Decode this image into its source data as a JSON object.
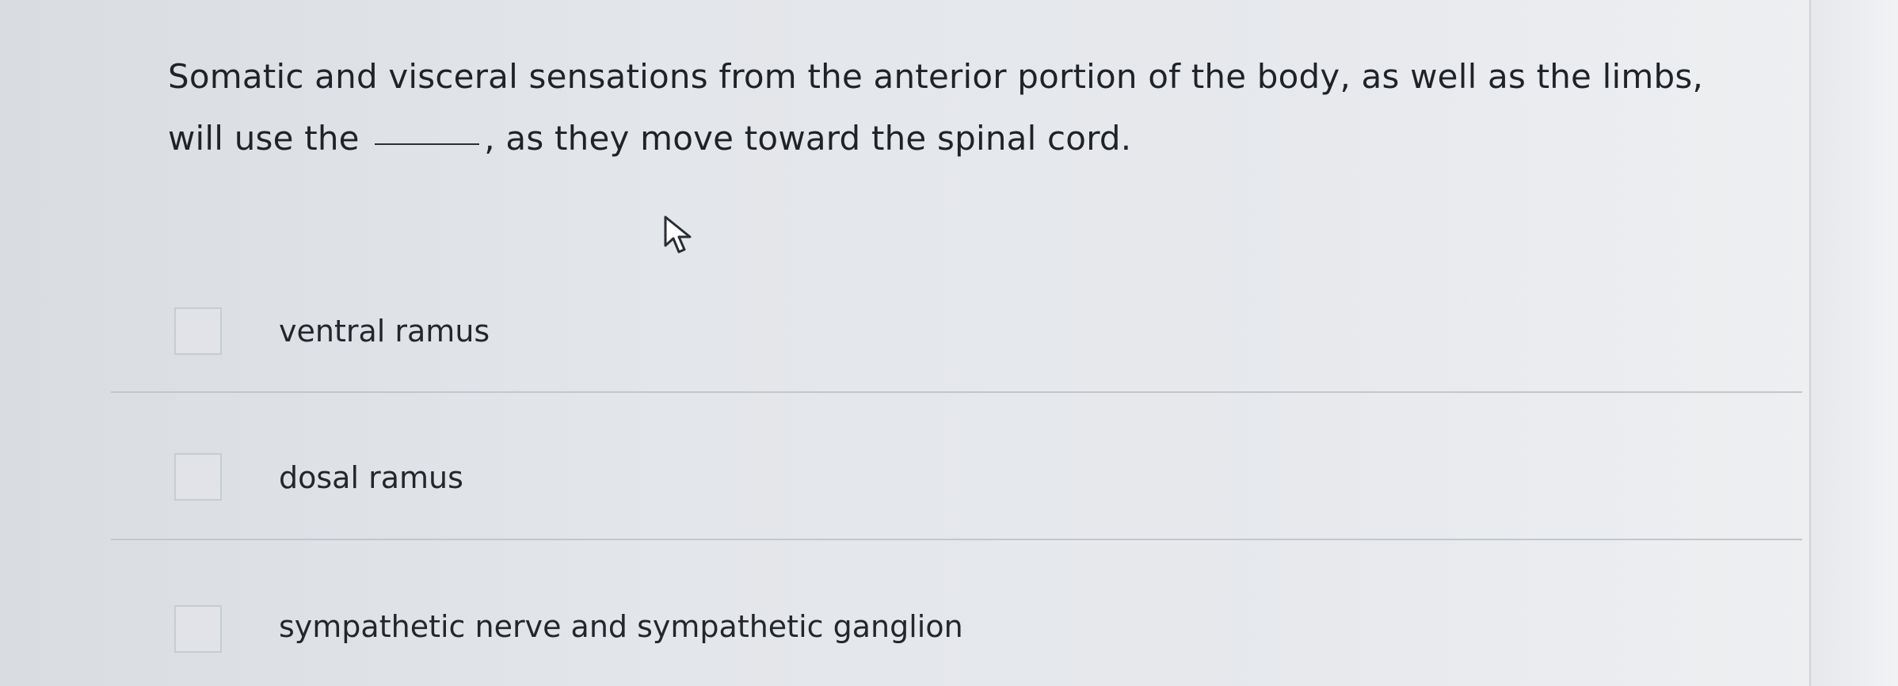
{
  "question": {
    "part1": "Somatic and visceral sensations from the anterior portion of the body, as well as the limbs, will use the",
    "part2": ", as they move toward the spinal cord."
  },
  "options": [
    {
      "label": "ventral ramus"
    },
    {
      "label": "dosal ramus"
    },
    {
      "label": "sympathetic nerve and sympathetic ganglion"
    }
  ]
}
